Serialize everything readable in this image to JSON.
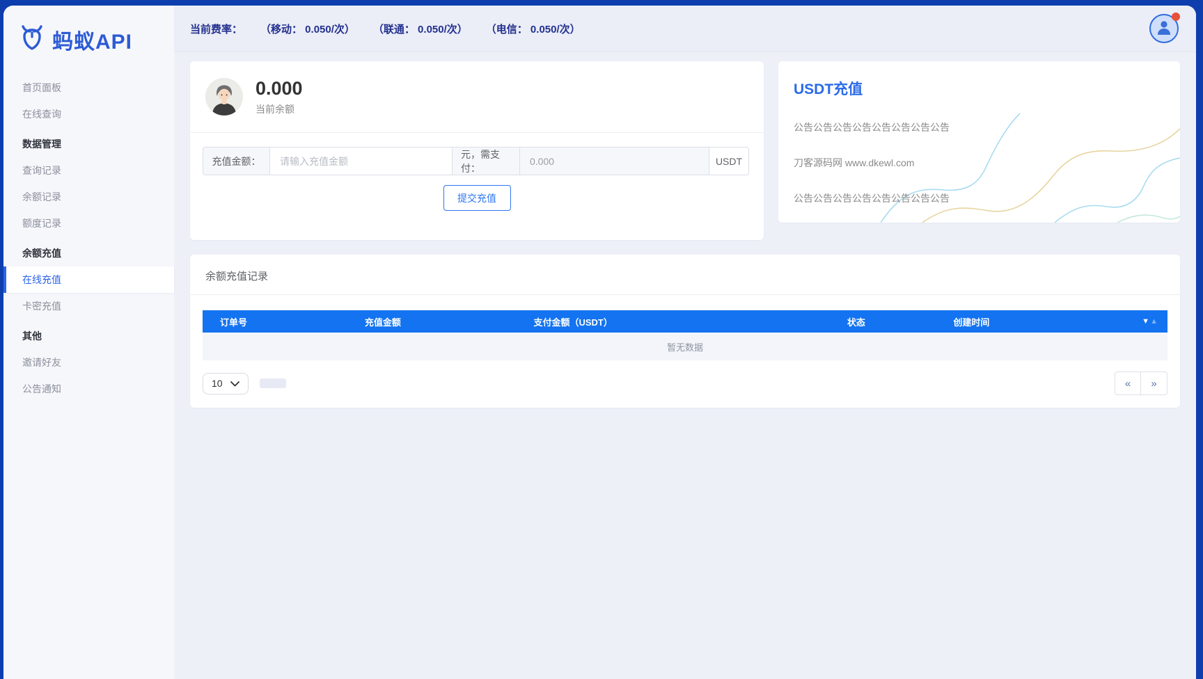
{
  "colors": {
    "frame_blue": "#0e3eae",
    "table_header_blue": "#1373f0",
    "accent_blue": "#2a63e8",
    "topbar_text_navy": "#22308e",
    "notification_red": "#e8503a",
    "wave_cyan": "#a8dcf0",
    "wave_tan": "#e6d49e"
  },
  "sidebar": {
    "logo_text": "蚂蚁API",
    "items": [
      {
        "label": "首页面板",
        "type": "item"
      },
      {
        "label": "在线查询",
        "type": "item"
      },
      {
        "label": "数据管理",
        "type": "header"
      },
      {
        "label": "查询记录",
        "type": "item"
      },
      {
        "label": "余额记录",
        "type": "item"
      },
      {
        "label": "额度记录",
        "type": "item"
      },
      {
        "label": "余额充值",
        "type": "header"
      },
      {
        "label": "在线充值",
        "type": "item",
        "active": true
      },
      {
        "label": "卡密充值",
        "type": "item"
      },
      {
        "label": "其他",
        "type": "header"
      },
      {
        "label": "邀请好友",
        "type": "item"
      },
      {
        "label": "公告通知",
        "type": "item"
      }
    ]
  },
  "topbar": {
    "rate_label": "当前费率：",
    "rates": [
      "（移动： 0.050/次）",
      "（联通： 0.050/次）",
      "（电信： 0.050/次）"
    ]
  },
  "balance": {
    "amount": "0.000",
    "label": "当前余额"
  },
  "recharge_form": {
    "amount_label": "充值金额：",
    "amount_placeholder": "请输入充值金额",
    "pay_label": "元，需支付：",
    "pay_value": "0.000",
    "currency": "USDT",
    "submit_label": "提交充值"
  },
  "usdt_panel": {
    "title": "USDT充值",
    "lines": [
      "公告公告公告公告公告公告公告公告",
      "刀客源码网 www.dkewl.com",
      "公告公告公告公告公告公告公告公告"
    ]
  },
  "records": {
    "title": "余额充值记录",
    "columns": [
      "订单号",
      "充值金额",
      "支付金额（USDT）",
      "状态",
      "创建时间"
    ],
    "empty_text": "暂无数据",
    "page_size": "10"
  }
}
